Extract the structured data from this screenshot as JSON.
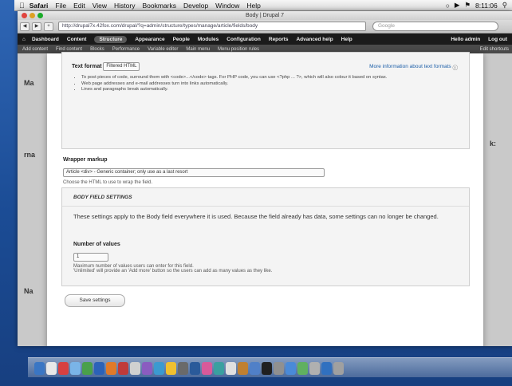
{
  "menubar": {
    "app": "Safari",
    "items": [
      "File",
      "Edit",
      "View",
      "History",
      "Bookmarks",
      "Develop",
      "Window",
      "Help"
    ],
    "clock": "8:11:06"
  },
  "window": {
    "title": "Body | Drupal 7"
  },
  "browser": {
    "url": "http://drupal7x.42fox.com/drupal/?q=admin/structure/types/manage/article/fields/body",
    "search_placeholder": "Google"
  },
  "drupal_toolbar": {
    "items": [
      "Dashboard",
      "Content",
      "Structure",
      "Appearance",
      "People",
      "Modules",
      "Configuration",
      "Reports",
      "Advanced help",
      "Help"
    ],
    "right": [
      "Hello admin",
      "Log out"
    ]
  },
  "shortcuts": {
    "items": [
      "Add content",
      "Find content",
      "Blocks",
      "Performance",
      "Variable editor",
      "Main menu",
      "Menu position rules"
    ],
    "right": "Edit shortcuts"
  },
  "text_format": {
    "label": "Text format",
    "selected": "Filtered HTML",
    "more_link": "More information about text formats",
    "tips": [
      "To post pieces of code, surround them with <code>...</code> tags. For PHP code, you can use <?php ... ?>, which will also colour it based on syntax.",
      "Web page addresses and e-mail addresses turn into links automatically.",
      "Lines and paragraphs break automatically."
    ]
  },
  "wrapper_markup": {
    "label": "Wrapper markup",
    "selected": "Article <div> - Generic container; only use as a last resort",
    "description": "Choose the HTML to use to wrap the field."
  },
  "body_settings": {
    "legend": "BODY FIELD SETTINGS",
    "text": "These settings apply to the Body field everywhere it is used. Because the field already has data, some settings can no longer be changed.",
    "number_label": "Number of values",
    "number_value": "1",
    "number_desc": "Maximum number of values users can enter for this field.",
    "number_desc2": "'Unlimited' will provide an 'Add more' button so the users can add as many values as they like."
  },
  "save_label": "Save settings",
  "background": {
    "h1": "Ma",
    "h2": "rna",
    "h3": "Na",
    "right": "k:"
  }
}
